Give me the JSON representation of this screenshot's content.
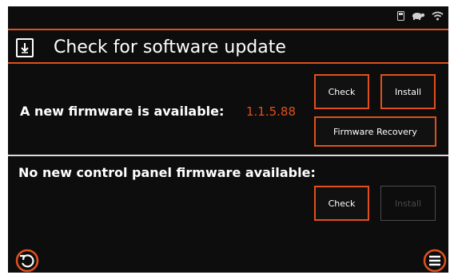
{
  "header": {
    "title": "Check for software update",
    "icon": "download-icon"
  },
  "status_icons": [
    "sd-card-icon",
    "turtle-icon",
    "wifi-icon"
  ],
  "firmware": {
    "label": "A new firmware is available:",
    "version": "1.1.5.88",
    "check_label": "Check",
    "install_label": "Install",
    "recovery_label": "Firmware Recovery"
  },
  "control_panel": {
    "label": "No new control panel firmware available:",
    "check_label": "Check",
    "install_label": "Install",
    "install_enabled": false
  },
  "footer": {
    "left_icon": "refresh-icon",
    "right_icon": "menu-icon"
  },
  "colors": {
    "accent": "#e0501c",
    "background": "#0d0d0d",
    "text": "#ffffff",
    "disabled": "#4a4a4a"
  }
}
